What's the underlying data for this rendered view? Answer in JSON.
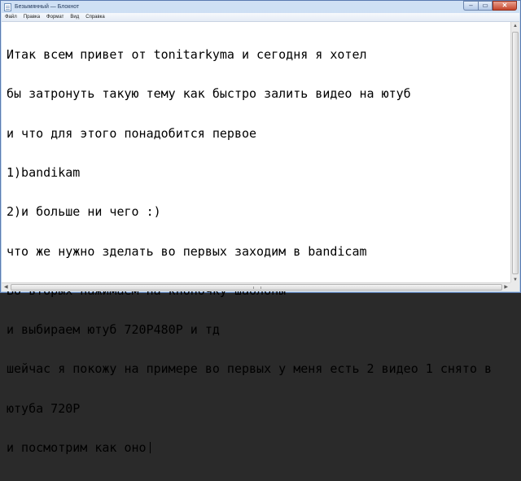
{
  "window": {
    "title": "Безымянный — Блокнот"
  },
  "menu": [
    {
      "label": "Файл"
    },
    {
      "label": "Правка"
    },
    {
      "label": "Формат"
    },
    {
      "label": "Вид"
    },
    {
      "label": "Справка"
    }
  ],
  "document": {
    "lines": [
      "Итак всем привет от tonitarkyma и сегодня я хотел",
      "бы затронуть такую тему как быстро залить видео на ютуб",
      "и что для этого понадобится первое",
      "1)bandikam",
      "2)и больше ни чего :)",
      "что же нужно зделать во первых заходим в bandicam",
      "Во вторых нажимаем на кнопочку шаблоны",
      "и выбираем ютуб 720P480P и тд",
      "шейчас я покожу на примере во первых у меня есть 2 видео 1 снято в",
      "ютуба 720P",
      "и посмотрим как оно"
    ]
  },
  "icons": {
    "app": "notepad-icon",
    "minimize": "minimize-icon",
    "maximize": "maximize-icon",
    "close": "close-icon"
  }
}
